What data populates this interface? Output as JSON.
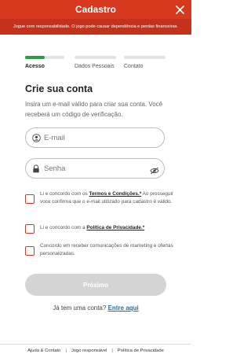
{
  "header": {
    "title": "Cadastro",
    "close_icon": "close-icon"
  },
  "banner": {
    "text": "Jogue com responsabilidade. O jogo pode causar dependência e perdas financeiras."
  },
  "steps": [
    {
      "label": "Acesso",
      "active": true,
      "progress": 0.5
    },
    {
      "label": "Dados Pessoais",
      "active": false,
      "progress": 0
    },
    {
      "label": "Contato",
      "active": false,
      "progress": 0
    }
  ],
  "form": {
    "title": "Crie sua conta",
    "subtitle": "Insira um e-mail válido para criar sua conta. Você receberá um código de verificação.",
    "email_placeholder": "E-mail",
    "email_value": "",
    "password_placeholder": "Senha",
    "password_value": ""
  },
  "checks": {
    "terms_prefix": "Li e concordo com os ",
    "terms_link": "Termos e Condições.*",
    "terms_suffix": " Ao prosseguir voce confirma que o e-mail utilizado para cadastro é válido.",
    "privacy_prefix": "Li e concordo com a ",
    "privacy_link": "Política de Privacidade.*",
    "marketing_text": "Concordo em receber comunicações de marketing e ofertas personalizadas."
  },
  "actions": {
    "next_label": "Próximo",
    "login_prompt": "Já tem uma conta? ",
    "login_link": "Entre aqui"
  },
  "footer": {
    "links": [
      "Ajuda & Contato",
      "Jogo responsável",
      "Política de Privacidade"
    ],
    "separator": "|"
  },
  "colors": {
    "brand": "#d7391f",
    "progress": "#2e9a3f",
    "link": "#1e6fb0",
    "disabled_button": "#d4d4d4"
  }
}
